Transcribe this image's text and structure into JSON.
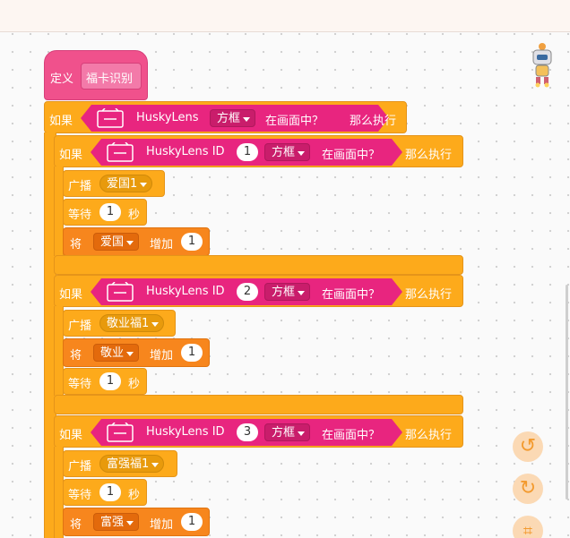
{
  "define_block": {
    "keyword": "定义",
    "name": "福卡识别"
  },
  "outer_if": {
    "if_label": "如果",
    "sensor": "HuskyLens",
    "dropdown": "方框",
    "condition": "在画面中？",
    "then_label": "那么执行"
  },
  "inner_ifs": [
    {
      "if_label": "如果",
      "sensor": "HuskyLens ID",
      "id": "1",
      "dropdown": "方框",
      "condition": "在画面中？",
      "then_label": "那么执行",
      "broadcast": {
        "label": "广播",
        "message": "爱国1"
      },
      "wait": {
        "label": "等待",
        "value": "1",
        "unit": "秒"
      },
      "change": {
        "label": "将",
        "var": "爱国",
        "op": "增加",
        "value": "1"
      }
    },
    {
      "if_label": "如果",
      "sensor": "HuskyLens ID",
      "id": "2",
      "dropdown": "方框",
      "condition": "在画面中？",
      "then_label": "那么执行",
      "broadcast": {
        "label": "广播",
        "message": "敬业福1"
      },
      "change": {
        "label": "将",
        "var": "敬业",
        "op": "增加",
        "value": "1"
      },
      "wait": {
        "label": "等待",
        "value": "1",
        "unit": "秒"
      }
    },
    {
      "if_label": "如果",
      "sensor": "HuskyLens ID",
      "id": "3",
      "dropdown": "方框",
      "condition": "在画面中？",
      "then_label": "那么执行",
      "broadcast": {
        "label": "广播",
        "message": "富强福1"
      },
      "wait": {
        "label": "等待",
        "value": "1",
        "unit": "秒"
      },
      "change": {
        "label": "将",
        "var": "富强",
        "op": "增加",
        "value": "1"
      }
    }
  ],
  "controls": {
    "undo_icon": "undo-icon",
    "redo_icon": "redo-icon",
    "crop_icon": "crop-icon",
    "mascot_icon": "robot-mascot-icon"
  },
  "colors": {
    "define": "#f0518c",
    "control": "#fdaa1b",
    "event": "#fdaa1b",
    "variable": "#f7861d",
    "huskylens": "#e8257f"
  }
}
